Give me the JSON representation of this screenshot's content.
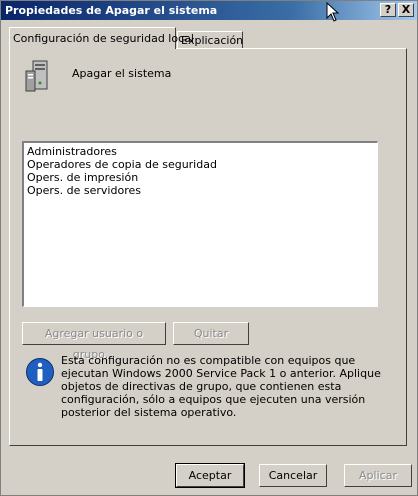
{
  "window": {
    "title": "Propiedades de Apagar el sistema"
  },
  "titlebar": {
    "help_label": "?",
    "close_label": "X"
  },
  "tabs": [
    {
      "label": "Configuración de seguridad local"
    },
    {
      "label": "Explicación"
    }
  ],
  "policy": {
    "title": "Apagar el sistema",
    "icon": "computer-policy-icon"
  },
  "users": {
    "items": [
      "Administradores",
      "Operadores de copia de seguridad",
      "Opers. de impresión",
      "Opers. de servidores"
    ]
  },
  "actions": {
    "add_label": "Agregar usuario o grupo...",
    "remove_label": "Quitar"
  },
  "info": {
    "icon": "info-icon",
    "text": "Esta configuración no es compatible con equipos que ejecutan Windows 2000 Service Pack 1 o anterior. Aplique objetos de directivas de grupo, que contienen esta configuración, sólo a equipos que ejecuten una versión posterior del sistema operativo."
  },
  "footer": {
    "ok_label": "Aceptar",
    "cancel_label": "Cancelar",
    "apply_label": "Aplicar"
  },
  "colors": {
    "title_start": "#0a246a",
    "title_end": "#a6caf0",
    "face": "#d4d0c8",
    "info_blue": "#1f5fbf"
  }
}
